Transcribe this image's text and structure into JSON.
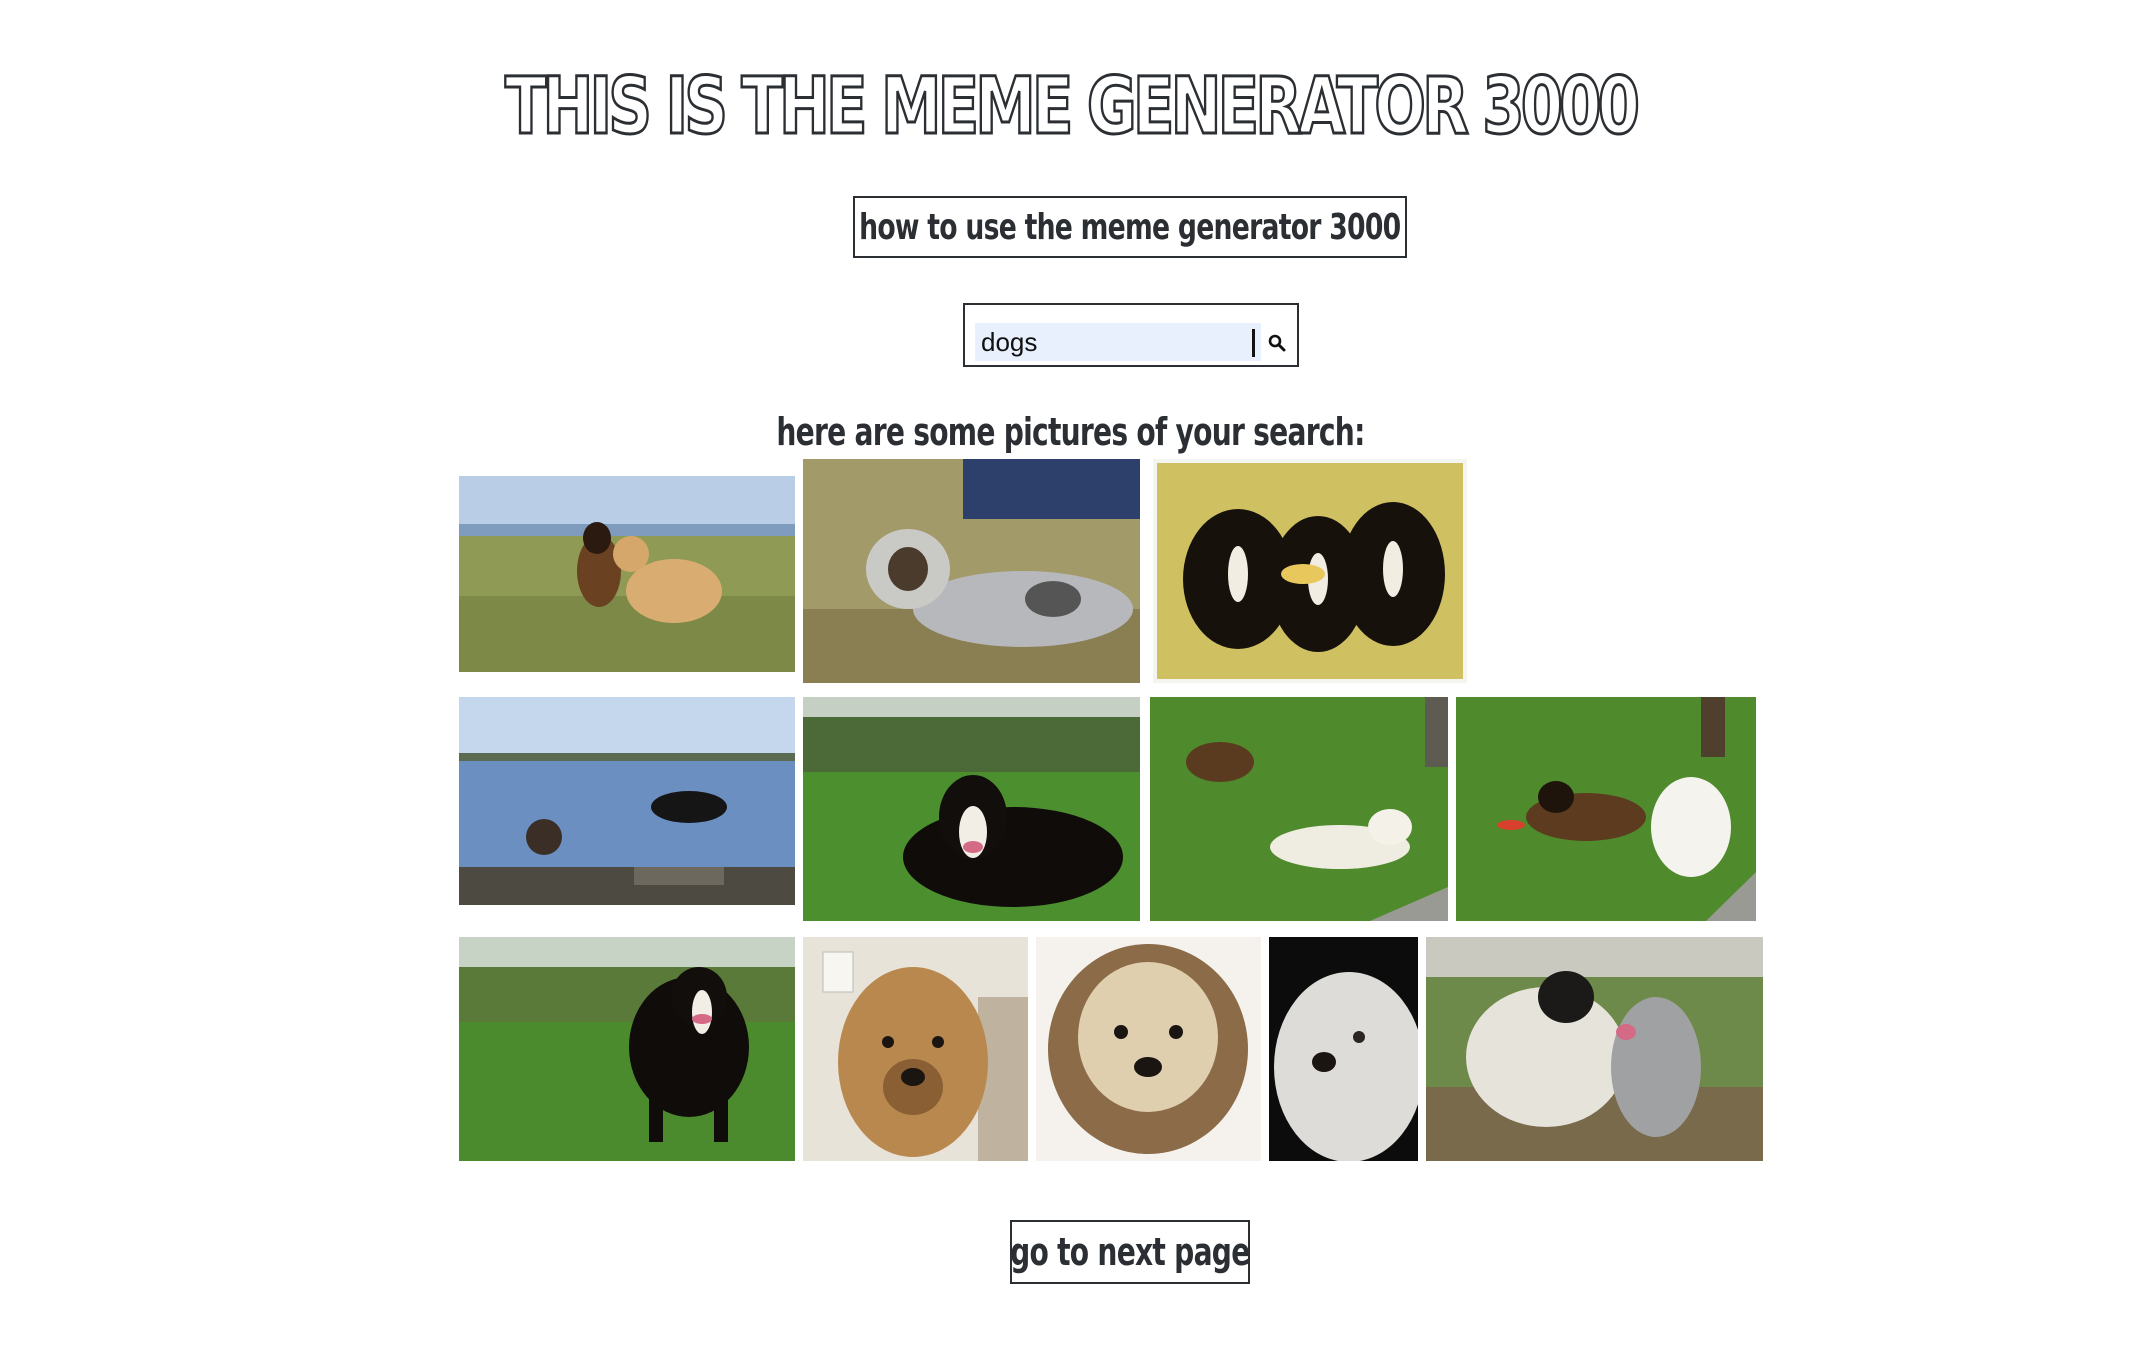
{
  "header": {
    "title": "THIS IS THE MEME GENERATOR 3000"
  },
  "help_button": {
    "label": "how to use the meme generator 3000"
  },
  "search": {
    "value": "dogs",
    "icon": "search-icon"
  },
  "results": {
    "heading": "here are some pictures of your search:",
    "images": [
      {
        "name": "photo-shepherd-and-retriever-playing"
      },
      {
        "name": "photo-australian-shepherd-lying"
      },
      {
        "name": "photo-three-bernese-puppies"
      },
      {
        "name": "photo-two-dogs-in-lake"
      },
      {
        "name": "photo-bernese-lying-on-grass"
      },
      {
        "name": "photo-shepherd-and-white-dog-lawn"
      },
      {
        "name": "photo-shepherd-and-white-dog-lawn-2"
      },
      {
        "name": "photo-bernese-standing"
      },
      {
        "name": "photo-tan-dog-portrait"
      },
      {
        "name": "photo-scruffy-terrier-portrait"
      },
      {
        "name": "photo-white-dog-black-background"
      },
      {
        "name": "photo-two-spotted-dogs"
      }
    ]
  },
  "next_button": {
    "label": "go to next page"
  },
  "colors": {
    "text": "#2b2f33",
    "input_bg": "#e8f0fe"
  }
}
